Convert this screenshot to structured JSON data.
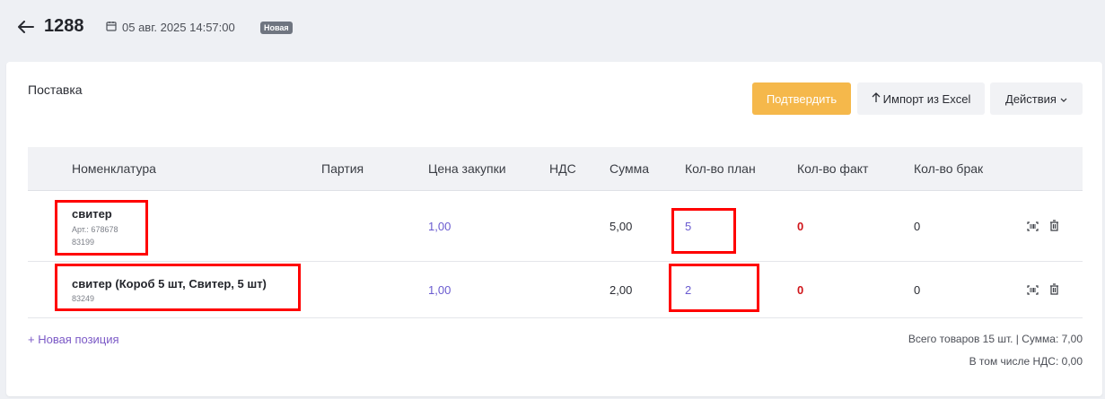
{
  "header": {
    "number": "1288",
    "date": "05 авг. 2025 14:57:00",
    "status": "Новая"
  },
  "card": {
    "title": "Поставка",
    "buttons": {
      "confirm": "Подтвердить",
      "import": "Импорт из Excel",
      "actions": "Действия"
    }
  },
  "table": {
    "columns": [
      "Номенклатура",
      "Партия",
      "Цена закупки",
      "НДС",
      "Сумма",
      "Кол-во план",
      "Кол-во факт",
      "Кол-во брак"
    ],
    "rows": [
      {
        "name": "свитер",
        "article": "Арт.: 678678",
        "code": "83199",
        "price": "1,00",
        "sum": "5,00",
        "qty_plan": "5",
        "qty_fact": "0",
        "qty_defect": "0"
      },
      {
        "name": "свитер (Короб 5 шт, Свитер, 5 шт)",
        "code": "83249",
        "price": "1,00",
        "sum": "2,00",
        "qty_plan": "2",
        "qty_fact": "0",
        "qty_defect": "0"
      }
    ]
  },
  "footer": {
    "add_position": "+ Новая позиция",
    "totals": "Всего товаров 15 шт. | Сумма: 7,00",
    "vat": "В том числе НДС: 0,00"
  },
  "colors": {
    "accent": "#f5b84b",
    "link": "#6a5bd0",
    "error": "#d0161b",
    "highlight": "#ff0000"
  }
}
